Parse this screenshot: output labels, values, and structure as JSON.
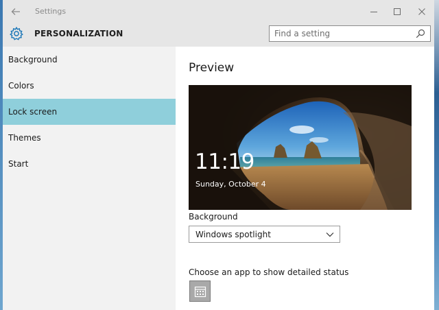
{
  "window": {
    "title": "Settings",
    "controls": [
      "minimize",
      "maximize",
      "close"
    ]
  },
  "header": {
    "section_title": "PERSONALIZATION",
    "icon": "gear-icon",
    "accent_color": "#1e78b8"
  },
  "search": {
    "placeholder": "Find a setting",
    "value": ""
  },
  "sidebar": {
    "items": [
      {
        "label": "Background",
        "selected": false
      },
      {
        "label": "Colors",
        "selected": false
      },
      {
        "label": "Lock screen",
        "selected": true
      },
      {
        "label": "Themes",
        "selected": false
      },
      {
        "label": "Start",
        "selected": false
      }
    ],
    "selected_color": "#8fcfdb"
  },
  "main": {
    "heading": "Preview",
    "preview": {
      "time": "11:19",
      "date": "Sunday, October 4"
    },
    "background": {
      "label": "Background",
      "selected_value": "Windows spotlight"
    },
    "status": {
      "label": "Choose an app to show detailed status",
      "app_icon": "calendar-icon"
    }
  }
}
